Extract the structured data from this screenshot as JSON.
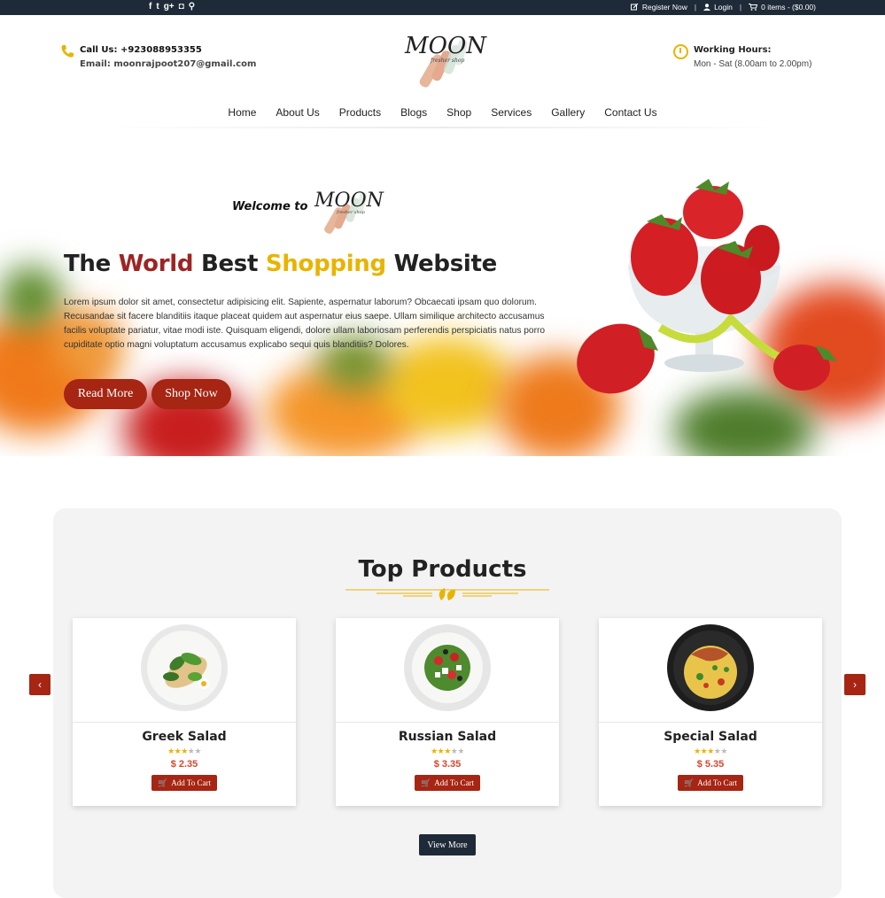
{
  "topbar": {
    "social_icons": [
      "facebook-icon",
      "twitter-icon",
      "google-plus-icon",
      "instagram-icon",
      "search-icon"
    ],
    "social_glyphs": [
      "f",
      "t",
      "g+",
      "◘",
      "⚲"
    ],
    "register": "Register Now",
    "login": "Login",
    "cart": "0 items - ($0.00)",
    "separator": "|"
  },
  "header": {
    "call": "Call Us: +923088953355",
    "email": "Email: moonrajpoot207@gmail.com",
    "logo_text": "MOON",
    "logo_sub": "fresher shop",
    "hours_title": "Working Hours:",
    "hours_text": "Mon - Sat (8.00am to 2.00pm)"
  },
  "nav": {
    "items": [
      "Home",
      "About Us",
      "Products",
      "Blogs",
      "Shop",
      "Services",
      "Gallery",
      "Contact Us"
    ]
  },
  "hero": {
    "welcome": "Welcome to",
    "headline_1": "The ",
    "headline_2": "World",
    "headline_3": " Best ",
    "headline_4": "Shopping",
    "headline_5": " Website",
    "body": "Lorem ipsum dolor sit amet, consectetur adipisicing elit. Sapiente, aspernatur laborum? Obcaecati ipsam quo dolorum. Recusandae sit facere blanditiis itaque placeat quidem aut aspernatur eius saepe. Ullam similique architecto accusamus facilis voluptate pariatur, vitae modi iste. Quisquam eligendi, dolore ullam laboriosam perferendis perspiciatis natus porro cupiditate optio magni voluptatum accusamus explicabo sequi quis blanditiis? Dolores.",
    "read_more": "Read More",
    "shop_now": "Shop Now"
  },
  "products": {
    "title": "Top Products",
    "items": [
      {
        "name": "Greek Salad",
        "price": "$ 2.35",
        "rating": 3,
        "cart": "Add To Cart"
      },
      {
        "name": "Russian Salad",
        "price": "$ 3.35",
        "rating": 3,
        "cart": "Add To Cart"
      },
      {
        "name": "Special Salad",
        "price": "$ 5.35",
        "rating": 3,
        "cart": "Add To Cart"
      }
    ],
    "prev": "‹",
    "next": "›",
    "view_more": "View More"
  },
  "colors": {
    "accent_red": "#a62513",
    "accent_yellow": "#e8b400",
    "dark": "#1f2a38",
    "price_red": "#d9442b"
  }
}
